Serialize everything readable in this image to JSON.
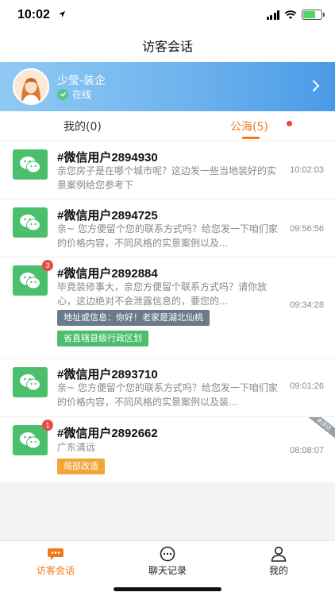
{
  "status_bar": {
    "time": "10:02"
  },
  "nav": {
    "title": "访客会话"
  },
  "profile": {
    "name": "少莹-装企",
    "status": "在线"
  },
  "tabs": [
    {
      "label": "我的(0)"
    },
    {
      "label": "公海(5)"
    }
  ],
  "conversations": [
    {
      "name": "#微信用户2894930",
      "message": "亲您房子是在哪个城市呢？这边发一些当地装好的实景案例给您参考下",
      "time": "10:02:03"
    },
    {
      "name": "#微信用户2894725",
      "message": "亲~ 您方便留个您的联系方式吗？给您发一下咱们家的价格内容，不同风格的实景案例以及...",
      "time": "09:56:56"
    },
    {
      "name": "#微信用户2892884",
      "badge": "3",
      "message": "毕竟装修事大，亲您方便留个联系方式吗？请你放心，这边绝对不会泄露信息的，要您的...",
      "time": "09:34:28",
      "tags": [
        "地址或信息：你好！老家是湖北仙桃",
        "省直辖县级行政区划"
      ]
    },
    {
      "name": "#微信用户2893710",
      "message": "亲~ 您方便留个您的联系方式吗？给您发一下咱们家的价格内容，不同风格的实景案例以及装...",
      "time": "09:01:26"
    },
    {
      "name": "#微信用户2892662",
      "badge": "1",
      "message": "广东清远",
      "time": "08:08:07",
      "tags": [
        "局部改造"
      ],
      "corner": "未读访"
    }
  ],
  "tabbar": [
    {
      "label": "访客会话",
      "icon": "chat-bubble-icon"
    },
    {
      "label": "聊天记录",
      "icon": "chat-dots-icon"
    },
    {
      "label": "我的",
      "icon": "person-icon"
    }
  ],
  "colors": {
    "accent": "#f07b1e",
    "wechat_green": "#4bbf6b",
    "banner": "#6fb3ee"
  }
}
